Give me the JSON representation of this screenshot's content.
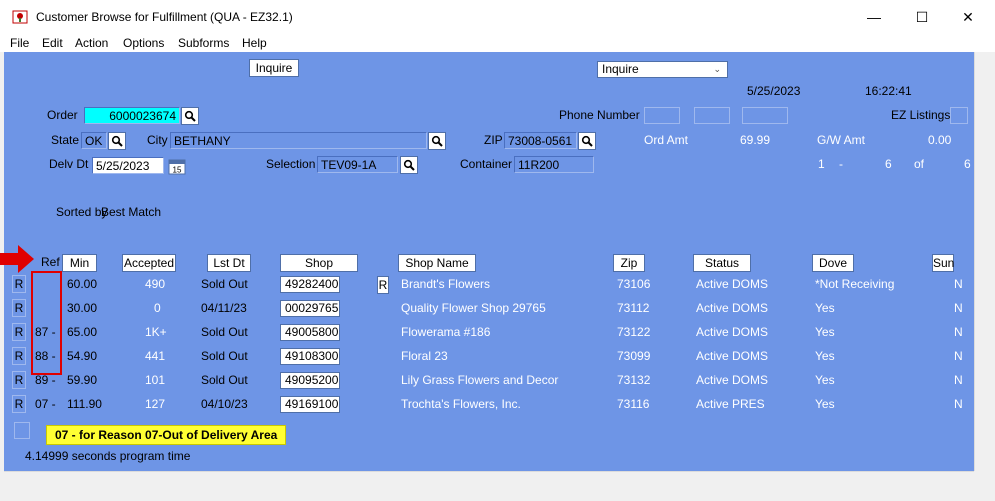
{
  "window": {
    "title": "Customer Browse for Fulfillment (QUA - EZ32.1)",
    "minimize": "—",
    "maximize": "☐",
    "close": "✕"
  },
  "menu": [
    "File",
    "Edit",
    "Action",
    "Options",
    "Subforms",
    "Help"
  ],
  "top": {
    "inquire_button": "Inquire",
    "inquire_combo": "Inquire",
    "date": "5/25/2023",
    "time": "16:22:41"
  },
  "form": {
    "order_label": "Order",
    "order_value": "6000023674",
    "phone_label": "Phone Number",
    "ez_listings_label": "EZ Listings",
    "state_label": "State",
    "state_value": "OK",
    "city_label": "City",
    "city_value": "BETHANY",
    "zip_label": "ZIP",
    "zip_value": "73008-0561",
    "ord_amt_label": "Ord Amt",
    "ord_amt_value": "69.99",
    "gw_amt_label": "G/W Amt",
    "gw_amt_value": "0.00",
    "delv_dt_label": "Delv Dt",
    "delv_dt_value": "5/25/2023",
    "calendar_day": "15",
    "selection_label": "Selection",
    "selection_value": "TEV09-1A",
    "container_label": "Container",
    "container_value": "11R200",
    "range_from": "1",
    "range_dash": "-",
    "range_to": "6",
    "range_of": "of",
    "range_total": "6",
    "sorted_by_label": "Sorted by",
    "sorted_by_value": "Best Match"
  },
  "columns": {
    "ref": "Ref",
    "min": "Min",
    "accepted": "Accepted",
    "lst_dt": "Lst Dt",
    "shop": "Shop",
    "shop_name": "Shop Name",
    "zip": "Zip",
    "status": "Status",
    "dove": "Dove",
    "sun": "Sun"
  },
  "rows": [
    {
      "r": "R",
      "ref": "",
      "min": "60.00",
      "accepted": "490",
      "lst_dt": "Sold Out",
      "shop": "49282400",
      "flag": "R",
      "shop_name": "Brandt's Flowers",
      "zip": "73106",
      "status": "Active DOMS",
      "dove": "*Not Receiving",
      "sun": "N"
    },
    {
      "r": "R",
      "ref": "",
      "min": "30.00",
      "accepted": "0",
      "lst_dt": "04/11/23",
      "shop": "00029765",
      "flag": "",
      "shop_name": "Quality Flower Shop 29765",
      "zip": "73112",
      "status": "Active DOMS",
      "dove": "Yes",
      "sun": "N"
    },
    {
      "r": "R",
      "ref": "87 -",
      "min": "65.00",
      "accepted": "1K+",
      "lst_dt": "Sold Out",
      "shop": "49005800",
      "flag": "",
      "shop_name": "Flowerama #186",
      "zip": "73122",
      "status": "Active DOMS",
      "dove": "Yes",
      "sun": "N"
    },
    {
      "r": "R",
      "ref": "88 -",
      "min": "54.90",
      "accepted": "441",
      "lst_dt": "Sold Out",
      "shop": "49108300",
      "flag": "",
      "shop_name": "Floral 23",
      "zip": "73099",
      "status": "Active DOMS",
      "dove": "Yes",
      "sun": "N"
    },
    {
      "r": "R",
      "ref": "89 -",
      "min": "59.90",
      "accepted": "101",
      "lst_dt": "Sold Out",
      "shop": "49095200",
      "flag": "",
      "shop_name": "Lily Grass Flowers and Decor",
      "zip": "73132",
      "status": "Active DOMS",
      "dove": "Yes",
      "sun": "N"
    },
    {
      "r": "R",
      "ref": "07 -",
      "min": "111.90",
      "accepted": "127",
      "lst_dt": "04/10/23",
      "shop": "49169100",
      "flag": "",
      "shop_name": "Trochta's Flowers, Inc.",
      "zip": "73116",
      "status": "Active PRES",
      "dove": "Yes",
      "sun": "N"
    }
  ],
  "tooltip": "07 - for Reason 07-Out of Delivery Area",
  "program_time": "4.14999 seconds program time",
  "colors": {
    "background": "#6e95e6",
    "highlight": "#00ffff",
    "tooltip": "#ffff33",
    "annotation_red": "#e00000"
  },
  "icons": [
    "app-icon",
    "search-icon",
    "calendar-icon",
    "red-arrow-icon"
  ]
}
